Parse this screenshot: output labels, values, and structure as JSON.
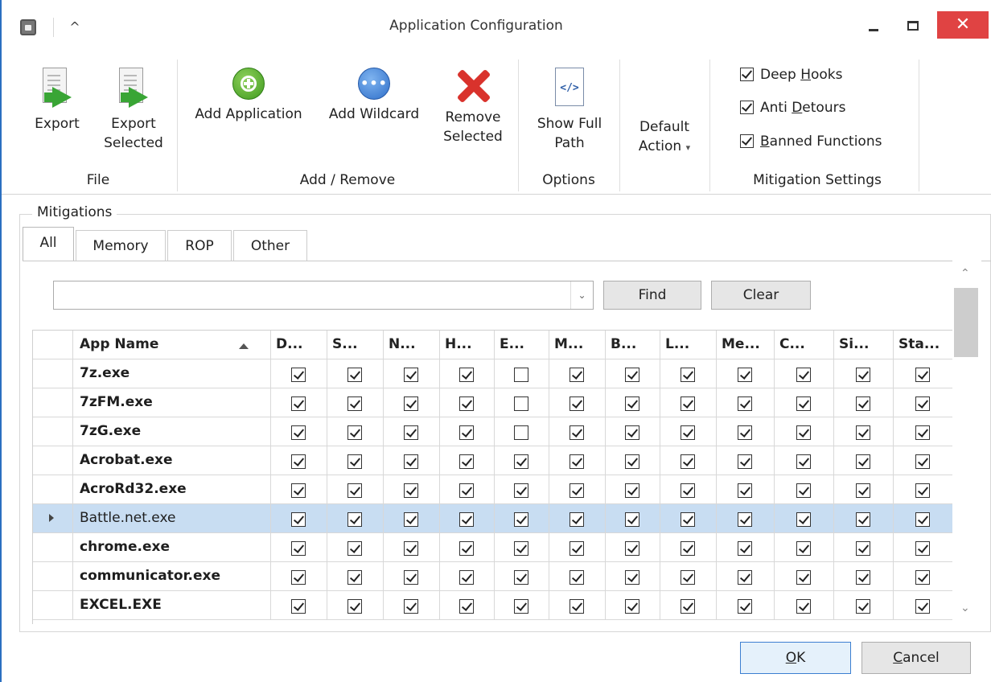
{
  "window": {
    "title": "Application Configuration",
    "collapse_glyph": "^",
    "close_glyph": "✕"
  },
  "ribbon": {
    "file": {
      "label": "File",
      "export": "Export",
      "export_selected_line1": "Export",
      "export_selected_line2": "Selected"
    },
    "add_remove": {
      "label": "Add / Remove",
      "add_application": "Add Application",
      "add_wildcard": "Add Wildcard",
      "remove_selected_line1": "Remove",
      "remove_selected_line2": "Selected"
    },
    "options": {
      "label": "Options",
      "show_full_path_line1": "Show Full",
      "show_full_path_line2": "Path",
      "code_glyph": "</>"
    },
    "default_action": {
      "line1": "Default",
      "line2": "Action",
      "caret": "▾"
    },
    "mitigation_settings": {
      "label": "Mitigation Settings",
      "deep_hooks": {
        "pre": "Deep ",
        "accel": "H",
        "post": "ooks",
        "checked": true
      },
      "anti_detours": {
        "pre": "Anti ",
        "accel": "D",
        "post": "etours",
        "checked": true
      },
      "banned_functions": {
        "pre": "",
        "accel": "B",
        "post": "anned Functions",
        "checked": true
      }
    }
  },
  "mitigations": {
    "group_label": "Mitigations",
    "tabs": [
      "All",
      "Memory",
      "ROP",
      "Other"
    ],
    "active_tab": "All",
    "search": {
      "value": "",
      "placeholder": ""
    },
    "find_label": "Find",
    "clear_label": "Clear"
  },
  "grid": {
    "columns": [
      "App Name",
      "D...",
      "S...",
      "N...",
      "H...",
      "E...",
      "M...",
      "B...",
      "L...",
      "Me...",
      "C...",
      "Si...",
      "Sta..."
    ],
    "sort": "ascending",
    "selected_row": 5,
    "rows": [
      {
        "name": "7z.exe",
        "checks": [
          true,
          true,
          true,
          true,
          false,
          true,
          true,
          true,
          true,
          true,
          true,
          true
        ]
      },
      {
        "name": "7zFM.exe",
        "checks": [
          true,
          true,
          true,
          true,
          false,
          true,
          true,
          true,
          true,
          true,
          true,
          true
        ]
      },
      {
        "name": "7zG.exe",
        "checks": [
          true,
          true,
          true,
          true,
          false,
          true,
          true,
          true,
          true,
          true,
          true,
          true
        ]
      },
      {
        "name": "Acrobat.exe",
        "checks": [
          true,
          true,
          true,
          true,
          true,
          true,
          true,
          true,
          true,
          true,
          true,
          true
        ]
      },
      {
        "name": "AcroRd32.exe",
        "checks": [
          true,
          true,
          true,
          true,
          true,
          true,
          true,
          true,
          true,
          true,
          true,
          true
        ]
      },
      {
        "name": "Battle.net.exe",
        "checks": [
          true,
          true,
          true,
          true,
          true,
          true,
          true,
          true,
          true,
          true,
          true,
          true
        ]
      },
      {
        "name": "chrome.exe",
        "checks": [
          true,
          true,
          true,
          true,
          true,
          true,
          true,
          true,
          true,
          true,
          true,
          true
        ]
      },
      {
        "name": "communicator.exe",
        "checks": [
          true,
          true,
          true,
          true,
          true,
          true,
          true,
          true,
          true,
          true,
          true,
          true
        ]
      },
      {
        "name": "EXCEL.EXE",
        "checks": [
          true,
          true,
          true,
          true,
          true,
          true,
          true,
          true,
          true,
          true,
          true,
          true
        ]
      }
    ]
  },
  "footer": {
    "ok_accel": "O",
    "ok_rest": "K",
    "cancel_accel": "C",
    "cancel_rest": "ancel"
  },
  "colors": {
    "accent": "#2b6fc0",
    "close_red": "#e04343",
    "selected_row": "#c8ddf2"
  }
}
